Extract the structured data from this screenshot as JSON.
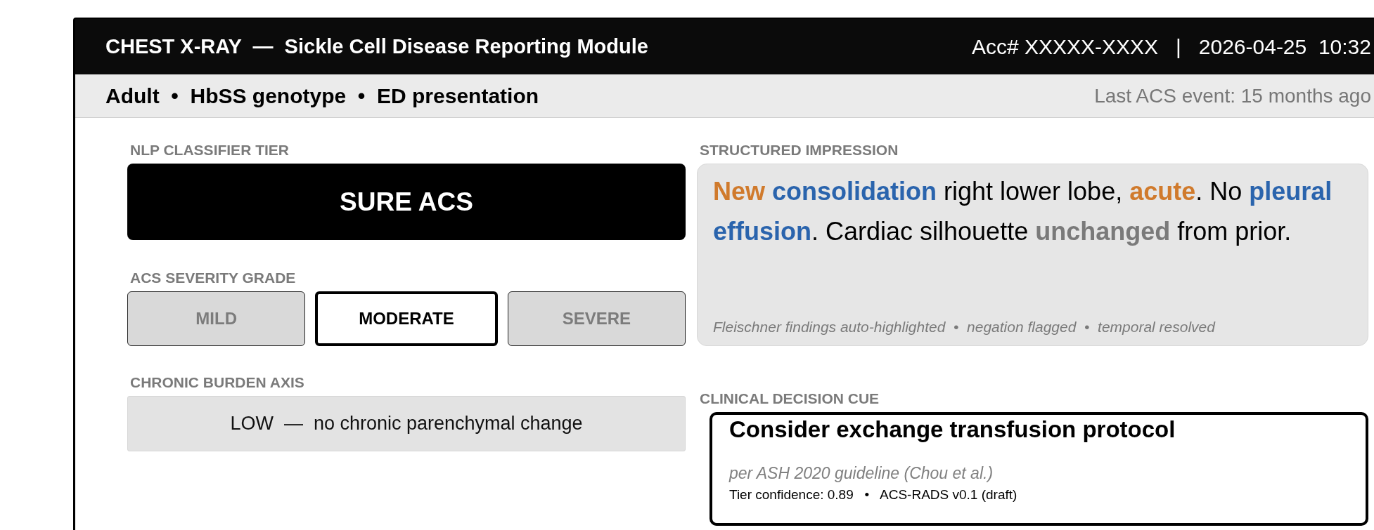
{
  "header": {
    "title": "CHEST X-RAY  —  Sickle Cell Disease Reporting Module",
    "accession": "Acc# XXXXX-XXXX   |   2026-04-25  10:32"
  },
  "context_bar": {
    "summary": "Adult  •  HbSS genotype  •  ED presentation",
    "last_event": "Last ACS event: 15 months ago"
  },
  "classifier": {
    "label": "NLP CLASSIFIER TIER",
    "tier": "SURE ACS"
  },
  "severity": {
    "label": "ACS SEVERITY GRADE",
    "options": [
      {
        "label": "MILD",
        "selected": false
      },
      {
        "label": "MODERATE",
        "selected": true
      },
      {
        "label": "SEVERE",
        "selected": false
      }
    ]
  },
  "chronic": {
    "label": "CHRONIC BURDEN AXIS",
    "value": "LOW  —  no chronic parenchymal change"
  },
  "impression": {
    "label": "STRUCTURED IMPRESSION",
    "segments": [
      {
        "kind": "temporal",
        "text": "New "
      },
      {
        "kind": "finding",
        "text": "consolidation"
      },
      {
        "kind": "plain",
        "text": " right lower lobe, "
      },
      {
        "kind": "temporal",
        "text": "acute"
      },
      {
        "kind": "plain",
        "text": ". No "
      },
      {
        "kind": "finding",
        "text": "pleural effusion"
      },
      {
        "kind": "plain",
        "text": ". Cardiac silhouette "
      },
      {
        "kind": "stable",
        "text": "unchanged"
      },
      {
        "kind": "plain",
        "text": " from prior."
      }
    ],
    "note": "Fleischner findings auto-highlighted  •  negation flagged  •  temporal resolved"
  },
  "decision_cue": {
    "label": "CLINICAL DECISION CUE",
    "title": "Consider exchange transfusion protocol",
    "source": "per ASH 2020 guideline (Chou et al.)",
    "footer": "Tier confidence: 0.89   •   ACS-RADS v0.1 (draft)"
  }
}
